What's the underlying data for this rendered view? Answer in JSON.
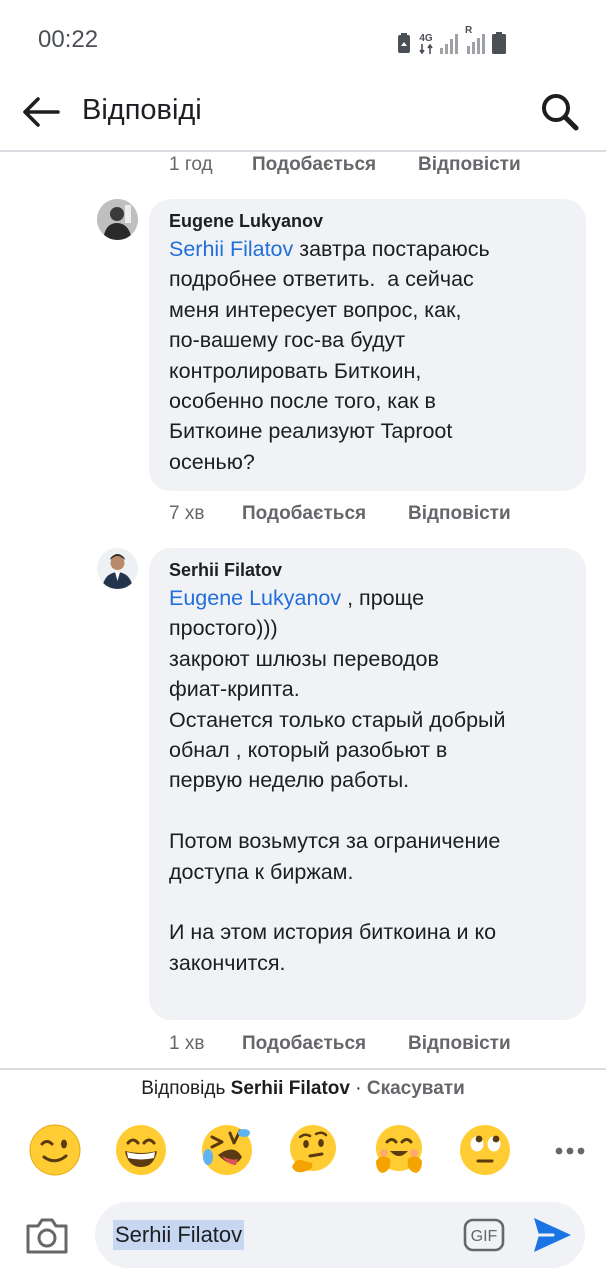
{
  "status_bar": {
    "time": "00:22",
    "network_label": "4G",
    "roaming_label": "R",
    "icons": [
      "recycle-notification-icon",
      "4g-data-icon",
      "signal-icon",
      "signal-roaming-icon",
      "battery-icon"
    ]
  },
  "header": {
    "title": "Відповіді",
    "back_icon": "arrow-left-icon",
    "search_icon": "search-icon"
  },
  "top_meta": {
    "time": "1 год",
    "like": "Подобається",
    "reply": "Відповісти"
  },
  "comments": [
    {
      "author": "Eugene Lukyanov",
      "mention": "Serhii Filatov",
      "text": " завтра постараюсь\nподробнее ответить.  а сейчас\nменя интересует вопрос, как,\nпо-вашему гос-ва будут\nконтролировать Биткоин,\nособенно после того, как в\nБиткоине реализуют Taproot\nосенью?",
      "time": "7 хв",
      "like": "Подобається",
      "reply": "Відповісти"
    },
    {
      "author": "Serhii Filatov",
      "mention": "Eugene Lukyanov",
      "text": " , проще\nпростого)))\nзакроют шлюзы переводов\nфиат-крипта.\nОстанется только старый добрый\nобнал , который разобьют в\nпервую неделю работы.\n\nПотом возьмутся за ограничение\nдоступа к биржам.\n\nИ на этом история биткоина и ко\nзакончится.",
      "time": "1 хв",
      "like": "Подобається",
      "reply": "Відповісти"
    }
  ],
  "reply_bar": {
    "prefix": "Відповідь",
    "name": "Serhii Filatov",
    "separator": " · ",
    "cancel": "Скасувати"
  },
  "emojis": [
    "winking-face",
    "grinning-face",
    "rolling-laughing-face",
    "thinking-face",
    "hugging-face",
    "eye-roll-face"
  ],
  "composer": {
    "value": "Serhii Filatov",
    "gif_label": "GIF",
    "camera_icon": "camera-icon",
    "send_icon": "send-icon"
  },
  "colors": {
    "mention": "#216fdb",
    "bubble": "#f0f2f5",
    "secondary_text": "#65676b",
    "send": "#1b74e4"
  }
}
